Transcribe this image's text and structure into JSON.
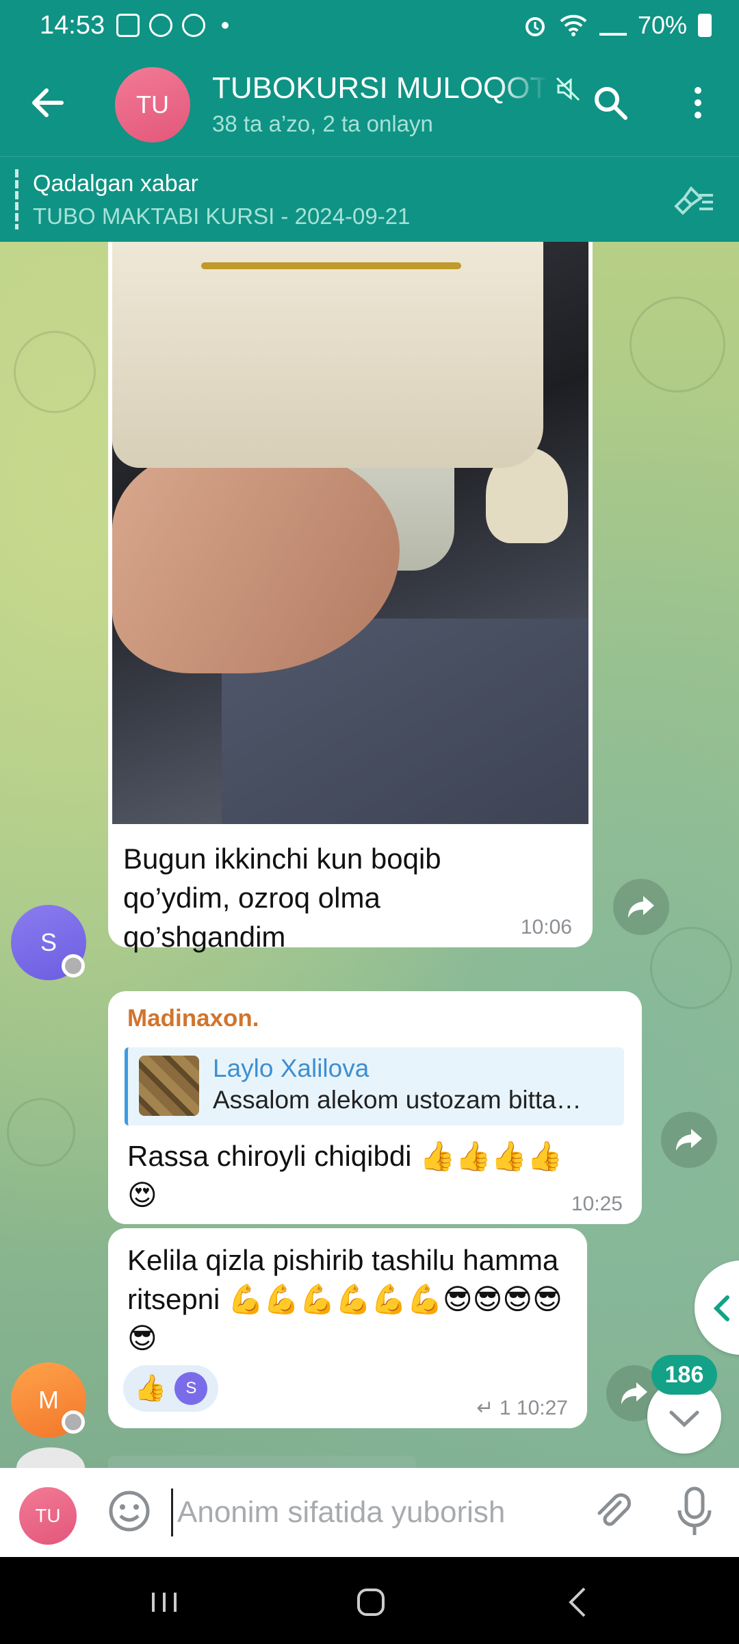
{
  "status_bar": {
    "time": "14:53",
    "battery": "70%"
  },
  "header": {
    "avatar_initials": "TU",
    "title": "TUBOKURSI MULOQOT",
    "subtitle": "38 ta a’zo, 2 ta onlayn"
  },
  "pinned": {
    "title": "Qadalgan xabar",
    "text": "TUBO MAKTABI KURSI - 2024-09-21"
  },
  "messages": {
    "m1": {
      "avatar_initial": "S",
      "text": "Bugun ikkinchi kun boqib qo’ydim, ozroq olma qo’shgandim",
      "time": "10:06"
    },
    "m2": {
      "sender": "Madinaxon.",
      "reply_name": "Laylo Xalilova",
      "reply_text": "Assalom alekom ustozam bitta…",
      "text": "Rassa chiroyli chiqibdi 👍👍👍👍😍",
      "time": "10:25"
    },
    "m3": {
      "avatar_initial": "M",
      "text": "Kelila qizla pishirib tashilu hamma  ritsepni 💪💪💪💪💪💪😎😎😎😎😎",
      "reaction_emoji": "👍",
      "reaction_avatar": "S",
      "reply_count": "1",
      "time": "10:27"
    }
  },
  "unread_count": "186",
  "composer": {
    "avatar_initials": "TU",
    "placeholder": "Anonim sifatida yuborish"
  },
  "colors": {
    "header": "#0f9384",
    "accent_sender": "#d2742c",
    "reply_accent": "#3d9be0",
    "badge": "#13a287"
  }
}
